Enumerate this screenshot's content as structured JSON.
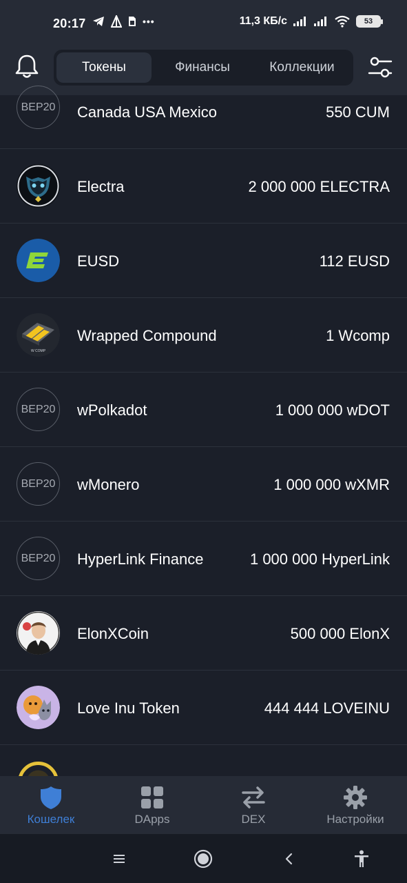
{
  "status_bar": {
    "time": "20:17",
    "network_speed": "11,3 КБ/с",
    "battery": "53",
    "more_indicator": "•••"
  },
  "header": {
    "tabs": [
      {
        "label": "Токены",
        "active": true
      },
      {
        "label": "Финансы",
        "active": false
      },
      {
        "label": "Коллекции",
        "active": false
      }
    ]
  },
  "tokens": [
    {
      "name": "Canada USA Mexico",
      "amount": "550 CUM",
      "avatar_text": "BEP20",
      "icon": "bep20-placeholder"
    },
    {
      "name": "Electra",
      "amount": "2 000 000 ELECTRA",
      "icon": "electra-logo"
    },
    {
      "name": "EUSD",
      "amount": "112 EUSD",
      "icon": "eusd-logo"
    },
    {
      "name": "Wrapped Compound",
      "amount": "1 Wcomp",
      "icon": "wcomp-logo"
    },
    {
      "name": "wPolkadot",
      "amount": "1 000 000 wDOT",
      "avatar_text": "BEP20",
      "icon": "bep20-placeholder"
    },
    {
      "name": "wMonero",
      "amount": "1 000 000 wXMR",
      "avatar_text": "BEP20",
      "icon": "bep20-placeholder"
    },
    {
      "name": "HyperLink Finance",
      "amount": "1 000 000 HyperLink",
      "avatar_text": "BEP20",
      "icon": "bep20-placeholder"
    },
    {
      "name": "ElonXCoin",
      "amount": "500 000 ElonX",
      "icon": "elonx-logo"
    },
    {
      "name": "Love Inu Token",
      "amount": "444 444 LOVEINU",
      "icon": "loveinu-logo"
    }
  ],
  "bottom_nav": [
    {
      "label": "Кошелек",
      "icon": "shield-icon",
      "active": true
    },
    {
      "label": "DApps",
      "icon": "grid-icon",
      "active": false
    },
    {
      "label": "DEX",
      "icon": "swap-arrows-icon",
      "active": false
    },
    {
      "label": "Настройки",
      "icon": "gear-icon",
      "active": false
    }
  ],
  "colors": {
    "background": "#1b1f29",
    "bar": "#262b36",
    "accent": "#3f7fd6",
    "inactive": "#9aa0a9"
  }
}
